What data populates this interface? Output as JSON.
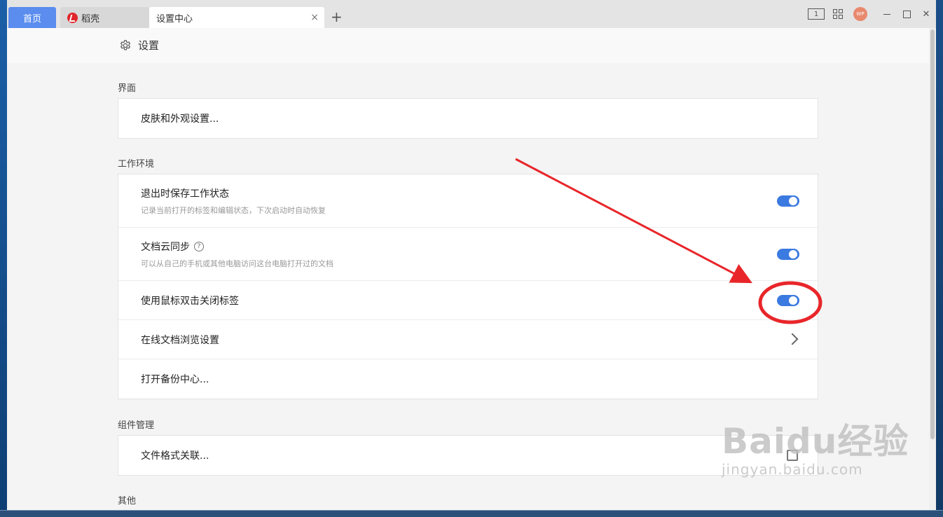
{
  "tabs": {
    "home": "首页",
    "docer": "稻壳",
    "settings": "设置中心",
    "close": "×",
    "add": "+"
  },
  "window_controls": {
    "mode": "1",
    "avatar": "WP",
    "close": "✕"
  },
  "header": {
    "title": "设置"
  },
  "sections": {
    "interface": {
      "title": "界面",
      "skin": "皮肤和外观设置..."
    },
    "workspace": {
      "title": "工作环境",
      "save_state": {
        "label": "退出时保存工作状态",
        "desc": "记录当前打开的标签和编辑状态，下次启动时自动恢复",
        "enabled": true
      },
      "cloud_sync": {
        "label": "文档云同步",
        "help": "?",
        "desc": "可以从自己的手机或其他电脑访问这台电脑打开过的文档",
        "enabled": true
      },
      "dblclick_close": {
        "label": "使用鼠标双击关闭标签",
        "enabled": true
      },
      "online_browse": {
        "label": "在线文档浏览设置"
      },
      "backup": {
        "label": "打开备份中心..."
      }
    },
    "components": {
      "title": "组件管理",
      "file_assoc": "文件格式关联..."
    },
    "other": {
      "title": "其他"
    }
  },
  "colors": {
    "accent": "#3b7ae0",
    "annotation": "#e8262a",
    "tab_home": "#5b8def"
  },
  "watermark": {
    "brand": "Baidu经验",
    "url": "jingyan.baidu.com"
  }
}
